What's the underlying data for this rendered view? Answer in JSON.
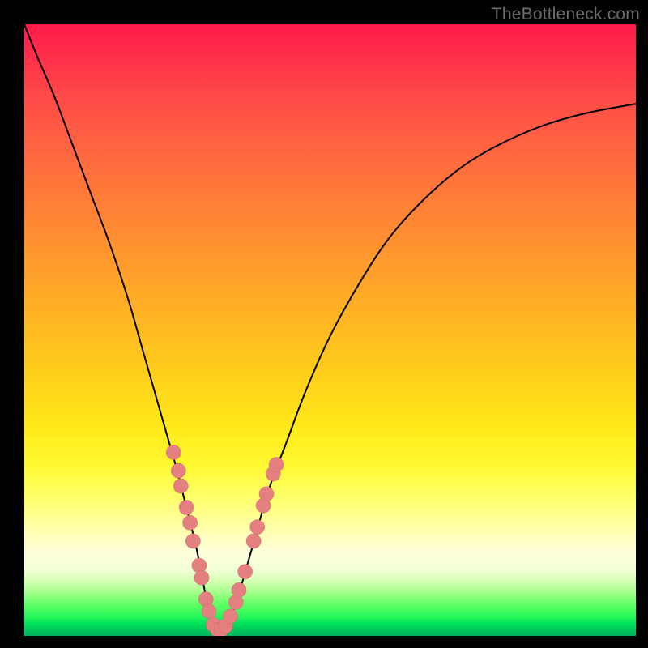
{
  "watermark": {
    "text": "TheBottleneck.com"
  },
  "colors": {
    "curve": "#000000",
    "marker_fill": "#e58080",
    "marker_stroke": "#d26a6a",
    "background_black": "#000000"
  },
  "chart_data": {
    "type": "line",
    "title": "",
    "xlabel": "",
    "ylabel": "",
    "xlim": [
      0,
      100
    ],
    "ylim": [
      0,
      100
    ],
    "grid": false,
    "legend": null,
    "series": [
      {
        "name": "bottleneck-curve",
        "x": [
          0,
          2,
          5,
          8,
          11,
          14,
          17,
          19,
          21,
          23,
          25,
          26.5,
          28,
          29,
          30,
          31,
          32,
          33,
          34.5,
          36,
          38,
          40,
          43,
          46,
          50,
          55,
          60,
          66,
          72,
          78,
          85,
          92,
          100
        ],
        "y": [
          100,
          95,
          88,
          80,
          72,
          64,
          55,
          48,
          41,
          34,
          27,
          21,
          15,
          10,
          5,
          2,
          0.5,
          2,
          5,
          10,
          17,
          24,
          32,
          40,
          49,
          58,
          65.5,
          72,
          77,
          80.5,
          83.5,
          85.5,
          87
        ]
      }
    ],
    "markers": {
      "name": "bottleneck-dots",
      "points": [
        {
          "x": 24.4,
          "y": 30.0
        },
        {
          "x": 25.2,
          "y": 27.0
        },
        {
          "x": 25.6,
          "y": 24.5
        },
        {
          "x": 26.5,
          "y": 21.0
        },
        {
          "x": 27.1,
          "y": 18.5
        },
        {
          "x": 27.6,
          "y": 15.5
        },
        {
          "x": 28.6,
          "y": 11.5
        },
        {
          "x": 29.0,
          "y": 9.5
        },
        {
          "x": 29.7,
          "y": 6.0
        },
        {
          "x": 30.2,
          "y": 4.0
        },
        {
          "x": 30.9,
          "y": 1.8
        },
        {
          "x": 31.6,
          "y": 1.0
        },
        {
          "x": 32.2,
          "y": 1.0
        },
        {
          "x": 32.9,
          "y": 1.6
        },
        {
          "x": 33.7,
          "y": 3.2
        },
        {
          "x": 34.6,
          "y": 5.5
        },
        {
          "x": 35.1,
          "y": 7.5
        },
        {
          "x": 36.1,
          "y": 10.5
        },
        {
          "x": 37.5,
          "y": 15.5
        },
        {
          "x": 38.1,
          "y": 17.8
        },
        {
          "x": 39.1,
          "y": 21.3
        },
        {
          "x": 39.6,
          "y": 23.2
        },
        {
          "x": 40.7,
          "y": 26.5
        },
        {
          "x": 41.2,
          "y": 28.0
        }
      ],
      "radius": 1.2
    }
  }
}
